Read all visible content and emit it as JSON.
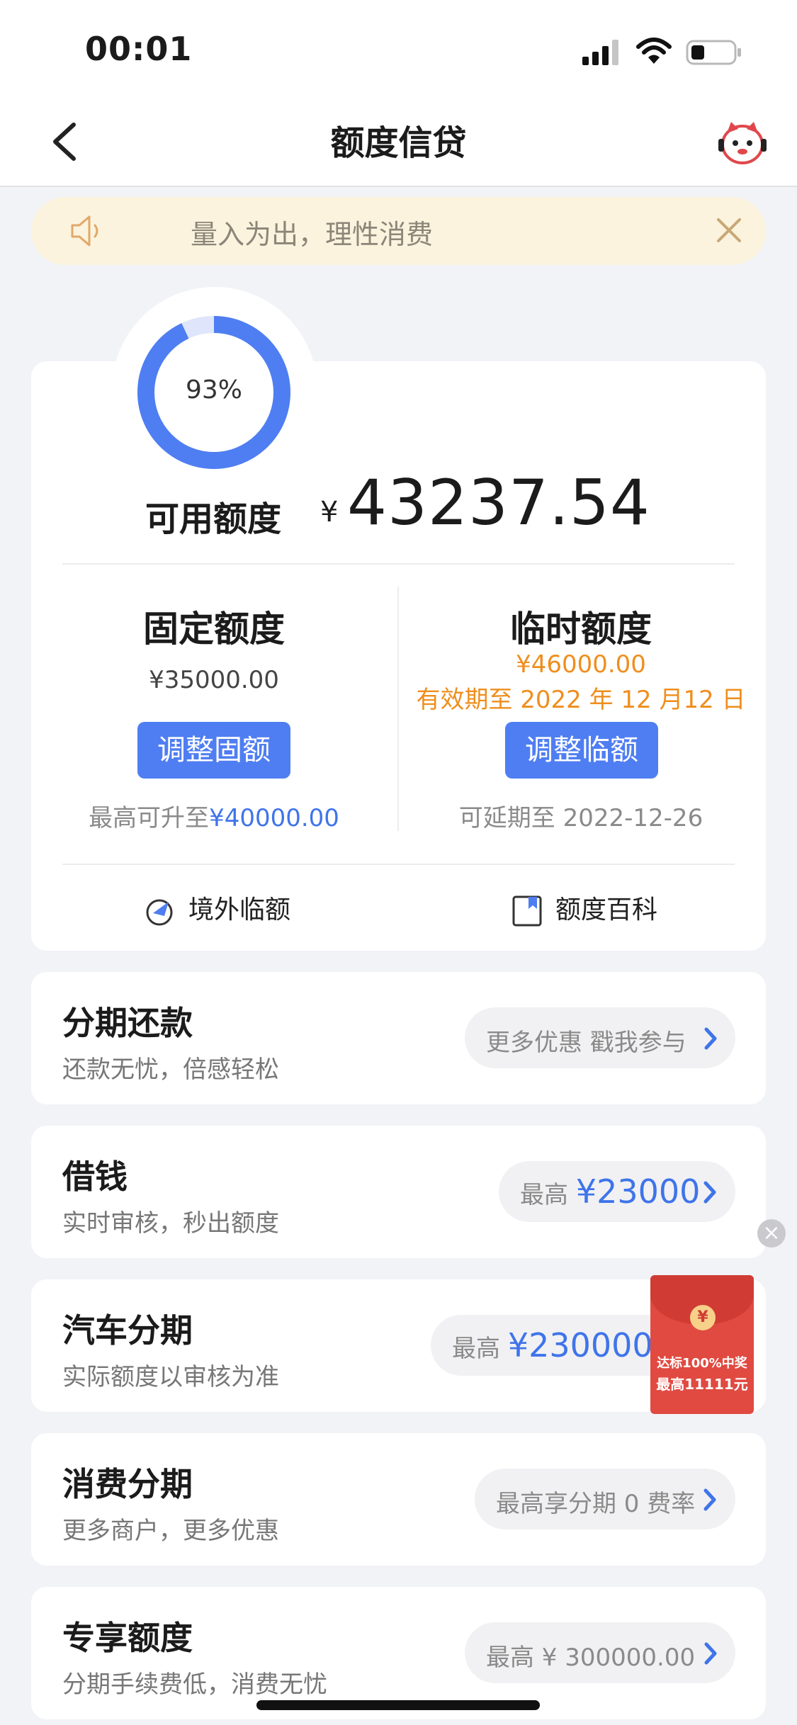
{
  "status_bar": {
    "time": "00:01"
  },
  "nav": {
    "title": "额度信贷"
  },
  "notice": {
    "text": "量入为出，理性消费"
  },
  "credit": {
    "percent": 0.93,
    "percent_label": "93%",
    "available_label": "可用额度",
    "currency": "¥",
    "available_amount": "43237.54"
  },
  "fixed": {
    "title": "固定额度",
    "amount": "¥35000.00",
    "button": "调整固额",
    "max_prefix": "最高可升至",
    "max_amount": "¥40000.00"
  },
  "temp": {
    "title": "临时额度",
    "amount": "¥46000.00",
    "validity": "有效期至 2022 年 12 月12 日",
    "button": "调整临额",
    "extend": "可延期至 2022-12-26"
  },
  "links": {
    "overseas": "境外临额",
    "wiki": "额度百科"
  },
  "products": [
    {
      "title": "分期还款",
      "subtitle": "还款无忧，倍感轻松",
      "pill_text": "更多优惠 戳我参与",
      "pill_amount": ""
    },
    {
      "title": "借钱",
      "subtitle": "实时审核，秒出额度",
      "pill_text": "最高",
      "pill_amount": "¥23000"
    },
    {
      "title": "汽车分期",
      "subtitle": "实际额度以审核为准",
      "pill_text": "最高",
      "pill_amount": "¥230000."
    },
    {
      "title": "消费分期",
      "subtitle": "更多商户，更多优惠",
      "pill_text": "最高享分期 0 费率",
      "pill_amount": ""
    },
    {
      "title": "专享额度",
      "subtitle": "分期手续费低，消费无忧",
      "pill_text": "最高 ¥ 300000.00",
      "pill_amount": ""
    }
  ],
  "promo": {
    "coin": "¥",
    "line1": "达标100%中奖",
    "line2": "最高11111元",
    "close": "×"
  },
  "colors": {
    "accent": "#4f7ef2",
    "orange": "#ef8e1e",
    "notice_bg": "#fbf3dd"
  },
  "icons": [
    "cellular-signal-icon",
    "wifi-icon",
    "battery-icon",
    "back-arrow-icon",
    "customer-service-icon",
    "speaker-icon",
    "close-icon",
    "globe-plane-icon",
    "book-icon",
    "chevron-right-icon",
    "red-envelope-icon"
  ]
}
